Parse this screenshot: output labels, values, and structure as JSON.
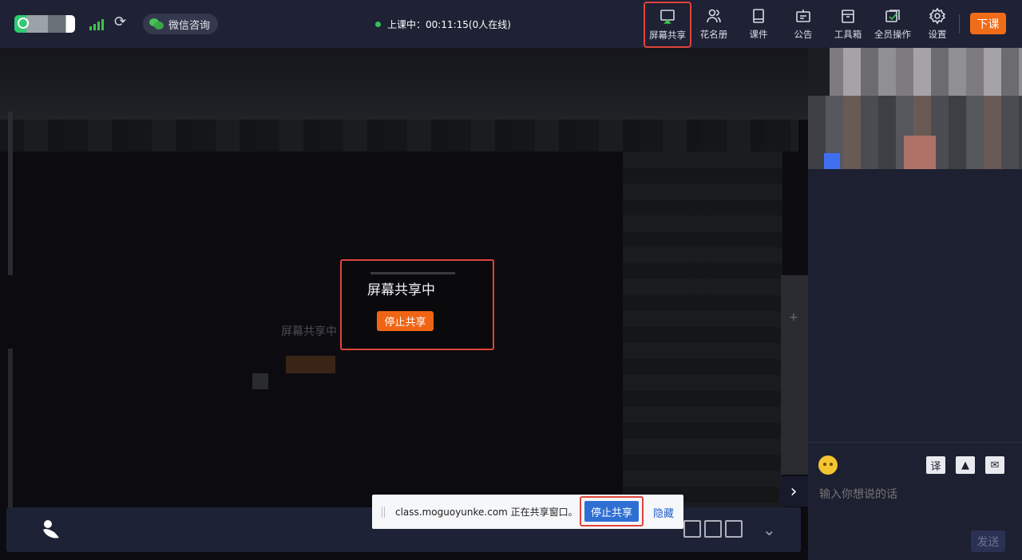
{
  "header": {
    "wechat_label": "微信咨询",
    "status_text": "上课中：00:11:15(0人在线)",
    "tools": [
      {
        "label": "屏幕共享",
        "icon": "screen-share-icon"
      },
      {
        "label": "花名册",
        "icon": "roster-icon"
      },
      {
        "label": "课件",
        "icon": "courseware-icon"
      },
      {
        "label": "公告",
        "icon": "announcement-icon"
      },
      {
        "label": "工具箱",
        "icon": "toolbox-icon"
      },
      {
        "label": "全员操作",
        "icon": "all-members-icon"
      },
      {
        "label": "设置",
        "icon": "gear-icon"
      }
    ],
    "end_class_label": "下课",
    "colors": {
      "bar": "#1f2235",
      "accent": "#f16c18",
      "signal": "#3fc24a"
    }
  },
  "stage": {
    "ghost_title": "屏幕共享中",
    "share_panel": {
      "title": "屏幕共享中",
      "stop_label": "停止共享"
    }
  },
  "share_notice": {
    "text": "class.moguoyunke.com 正在共享窗口。",
    "stop_label": "停止共享",
    "hide_label": "隐藏"
  },
  "chat": {
    "input_placeholder": "输入你想说的话",
    "send_label": "发送",
    "tools": [
      {
        "icon": "translate-icon",
        "glyph": "译"
      },
      {
        "icon": "image-icon",
        "glyph": "▲"
      },
      {
        "icon": "chat-mute-icon",
        "glyph": "✉"
      }
    ]
  }
}
